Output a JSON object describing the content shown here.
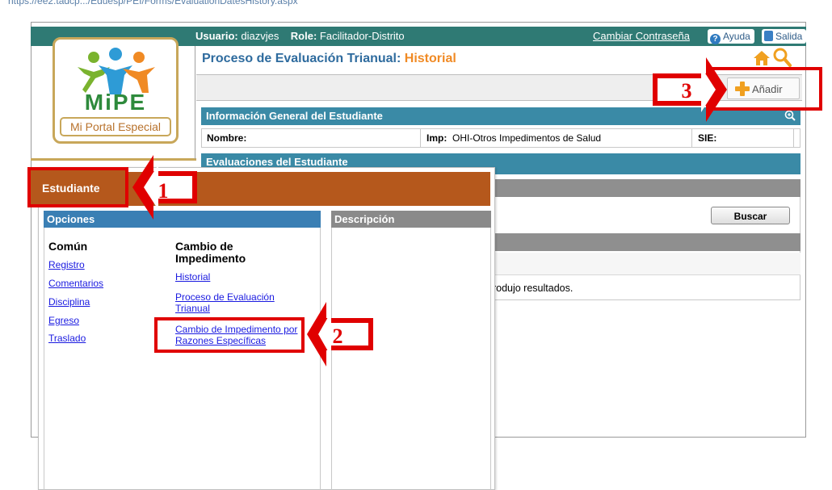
{
  "browser": {
    "url": "https://ee2.tadcp.../Eduesp/PEI/Forms/EvaluationDatesHistory.aspx"
  },
  "topbar": {
    "usuario_label": "Usuario:",
    "usuario_value": "diazvjes",
    "role_label": "Role:",
    "role_value": "Facilitador-Distrito",
    "cambiar": "Cambiar Contraseña",
    "ayuda": "Ayuda",
    "salida": "Salida"
  },
  "logo": {
    "name": "MiPE",
    "tagline": "Mi Portal Especial"
  },
  "page": {
    "title_prefix": "Proceso de Evaluación Trianual:",
    "title_highlight": "Historial",
    "add_button": "Añadir"
  },
  "student_info": {
    "header": "Información General del Estudiante",
    "nombre_label": "Nombre:",
    "nombre_value": "",
    "imp_label": "Imp:",
    "imp_value": "OHI-Otros Impedimentos de Salud",
    "sie_label": "SIE:",
    "sie_value": ""
  },
  "evaluations": {
    "header": "Evaluaciones del Estudiante",
    "search_button": "Buscar",
    "no_results": "produjo resultados."
  },
  "menu": {
    "tab": "Estudiante",
    "options_header": "Opciones",
    "description_header": "Descripción",
    "common": {
      "title": "Común",
      "items": [
        "Registro",
        "Comentarios",
        "Disciplina",
        "Egreso",
        "Traslado"
      ]
    },
    "impediment": {
      "title": "Cambio de Impedimento",
      "items": [
        "Historial",
        "Proceso de Evaluación Trianual",
        "Cambio de Impedimento por Razones Específicas"
      ]
    }
  },
  "callouts": [
    "1",
    "2",
    "3"
  ],
  "colors": {
    "topbar": "#2f7a74",
    "section_blue": "#3a8aa6",
    "title_blue": "#2e6b9e",
    "title_orange": "#f08a24",
    "menu_orange": "#b5581c",
    "callout_red": "#e00000"
  }
}
